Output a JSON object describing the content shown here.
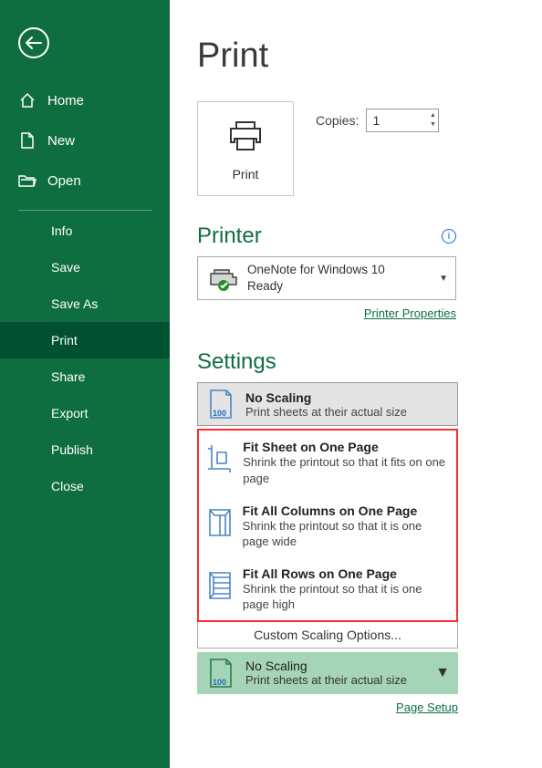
{
  "sidebar": {
    "home": "Home",
    "new": "New",
    "open": "Open",
    "info": "Info",
    "save": "Save",
    "saveAs": "Save As",
    "print": "Print",
    "share": "Share",
    "export": "Export",
    "publish": "Publish",
    "close": "Close"
  },
  "page": {
    "title": "Print",
    "printBtn": "Print",
    "copiesLabel": "Copies:",
    "copiesValue": "1"
  },
  "printer": {
    "section": "Printer",
    "name": "OneNote for Windows 10",
    "status": "Ready",
    "propsLink": "Printer Properties"
  },
  "settings": {
    "section": "Settings",
    "noScaling": {
      "title": "No Scaling",
      "desc": "Print sheets at their actual size",
      "iconNum": "100"
    },
    "fitSheet": {
      "title": "Fit Sheet on One Page",
      "desc": "Shrink the printout so that it fits on one page"
    },
    "fitCols": {
      "title": "Fit All Columns on One Page",
      "desc": "Shrink the printout so that it is one page wide"
    },
    "fitRows": {
      "title": "Fit All Rows on One Page",
      "desc": "Shrink the printout so that it is one page high"
    },
    "custom": "Custom Scaling Options...",
    "pageSetup": "Page Setup"
  }
}
